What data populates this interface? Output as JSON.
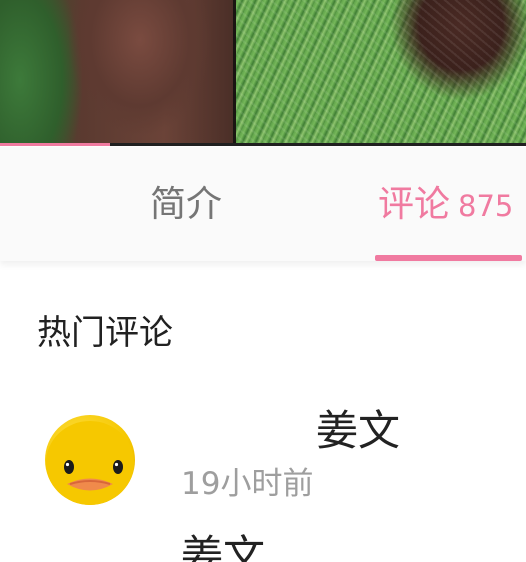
{
  "player": {
    "progress": 0.21
  },
  "tabs": {
    "intro": "简介",
    "comments": "评论",
    "comment_count": "875",
    "active": "comments"
  },
  "comments": {
    "section_title": "热门评论",
    "items": [
      {
        "user": "姜文",
        "time": "19小时前",
        "text": "姜文"
      }
    ]
  },
  "colors": {
    "accent": "#f07aa0",
    "muted_text": "#9e9e9e",
    "primary_text": "#222222",
    "inactive_tab": "#757575"
  },
  "icons": {
    "avatar": "duck-avatar-icon"
  }
}
